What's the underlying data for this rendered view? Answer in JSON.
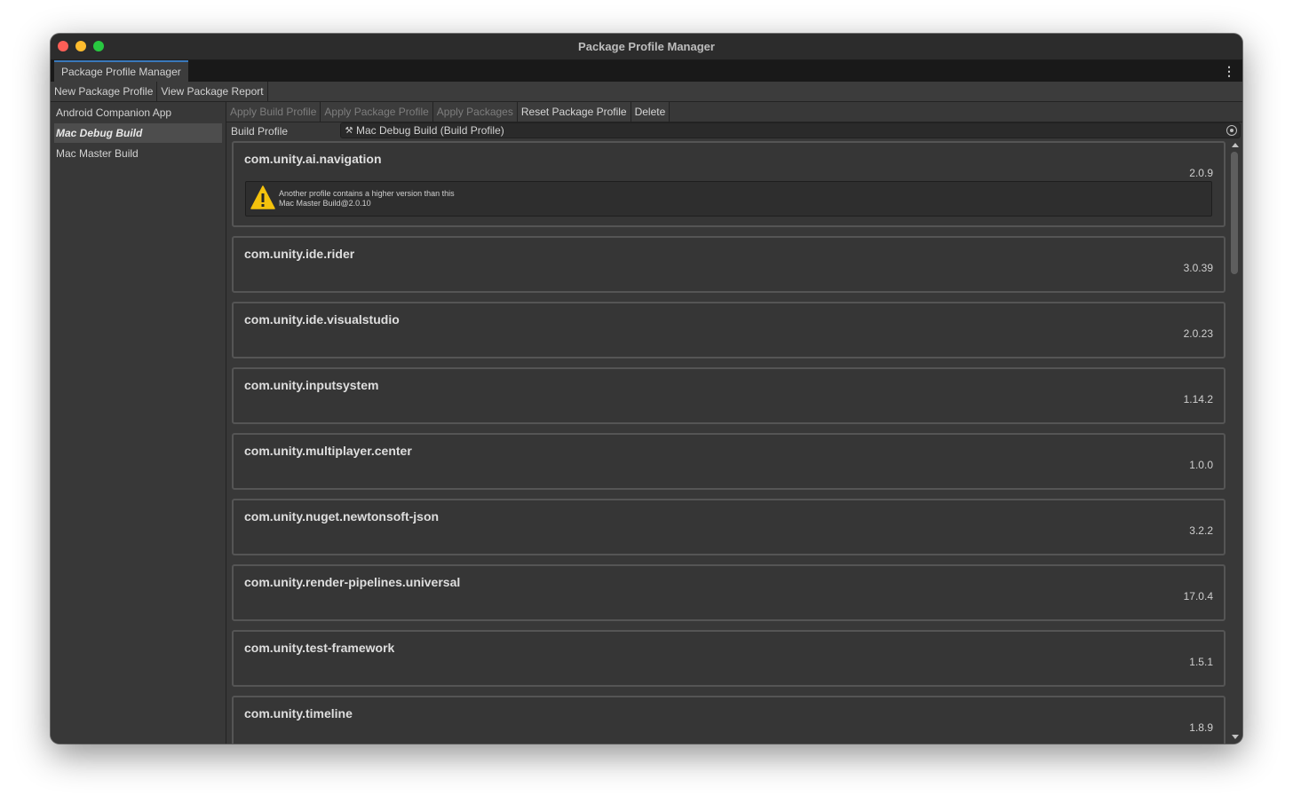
{
  "window": {
    "title": "Package Profile Manager"
  },
  "tab": {
    "label": "Package Profile Manager"
  },
  "toolbar": {
    "new_package_profile": "New Package Profile",
    "view_package_report": "View Package Report"
  },
  "sidebar": {
    "items": [
      {
        "label": "Android Companion App",
        "selected": false
      },
      {
        "label": "Mac Debug Build",
        "selected": true
      },
      {
        "label": "Mac Master Build",
        "selected": false
      }
    ]
  },
  "actions": {
    "apply_build_profile": "Apply Build Profile",
    "apply_package_profile": "Apply Package Profile",
    "apply_packages": "Apply Packages",
    "reset_package_profile": "Reset Package Profile",
    "delete": "Delete"
  },
  "build_profile": {
    "label": "Build Profile",
    "value": "Mac Debug Build (Build Profile)",
    "icon": "build-profile-icon"
  },
  "packages": [
    {
      "name": "com.unity.ai.navigation",
      "version": "2.0.9",
      "warning": {
        "line1": "Another profile contains a higher version than this",
        "line2": "Mac Master Build@2.0.10"
      }
    },
    {
      "name": "com.unity.ide.rider",
      "version": "3.0.39"
    },
    {
      "name": "com.unity.ide.visualstudio",
      "version": "2.0.23"
    },
    {
      "name": "com.unity.inputsystem",
      "version": "1.14.2"
    },
    {
      "name": "com.unity.multiplayer.center",
      "version": "1.0.0"
    },
    {
      "name": "com.unity.nuget.newtonsoft-json",
      "version": "3.2.2"
    },
    {
      "name": "com.unity.render-pipelines.universal",
      "version": "17.0.4"
    },
    {
      "name": "com.unity.test-framework",
      "version": "1.5.1"
    },
    {
      "name": "com.unity.timeline",
      "version": "1.8.9"
    }
  ],
  "colors": {
    "window_bg": "#383838",
    "tab_accent": "#3a79bb",
    "warning_icon": "#f4c20d"
  }
}
